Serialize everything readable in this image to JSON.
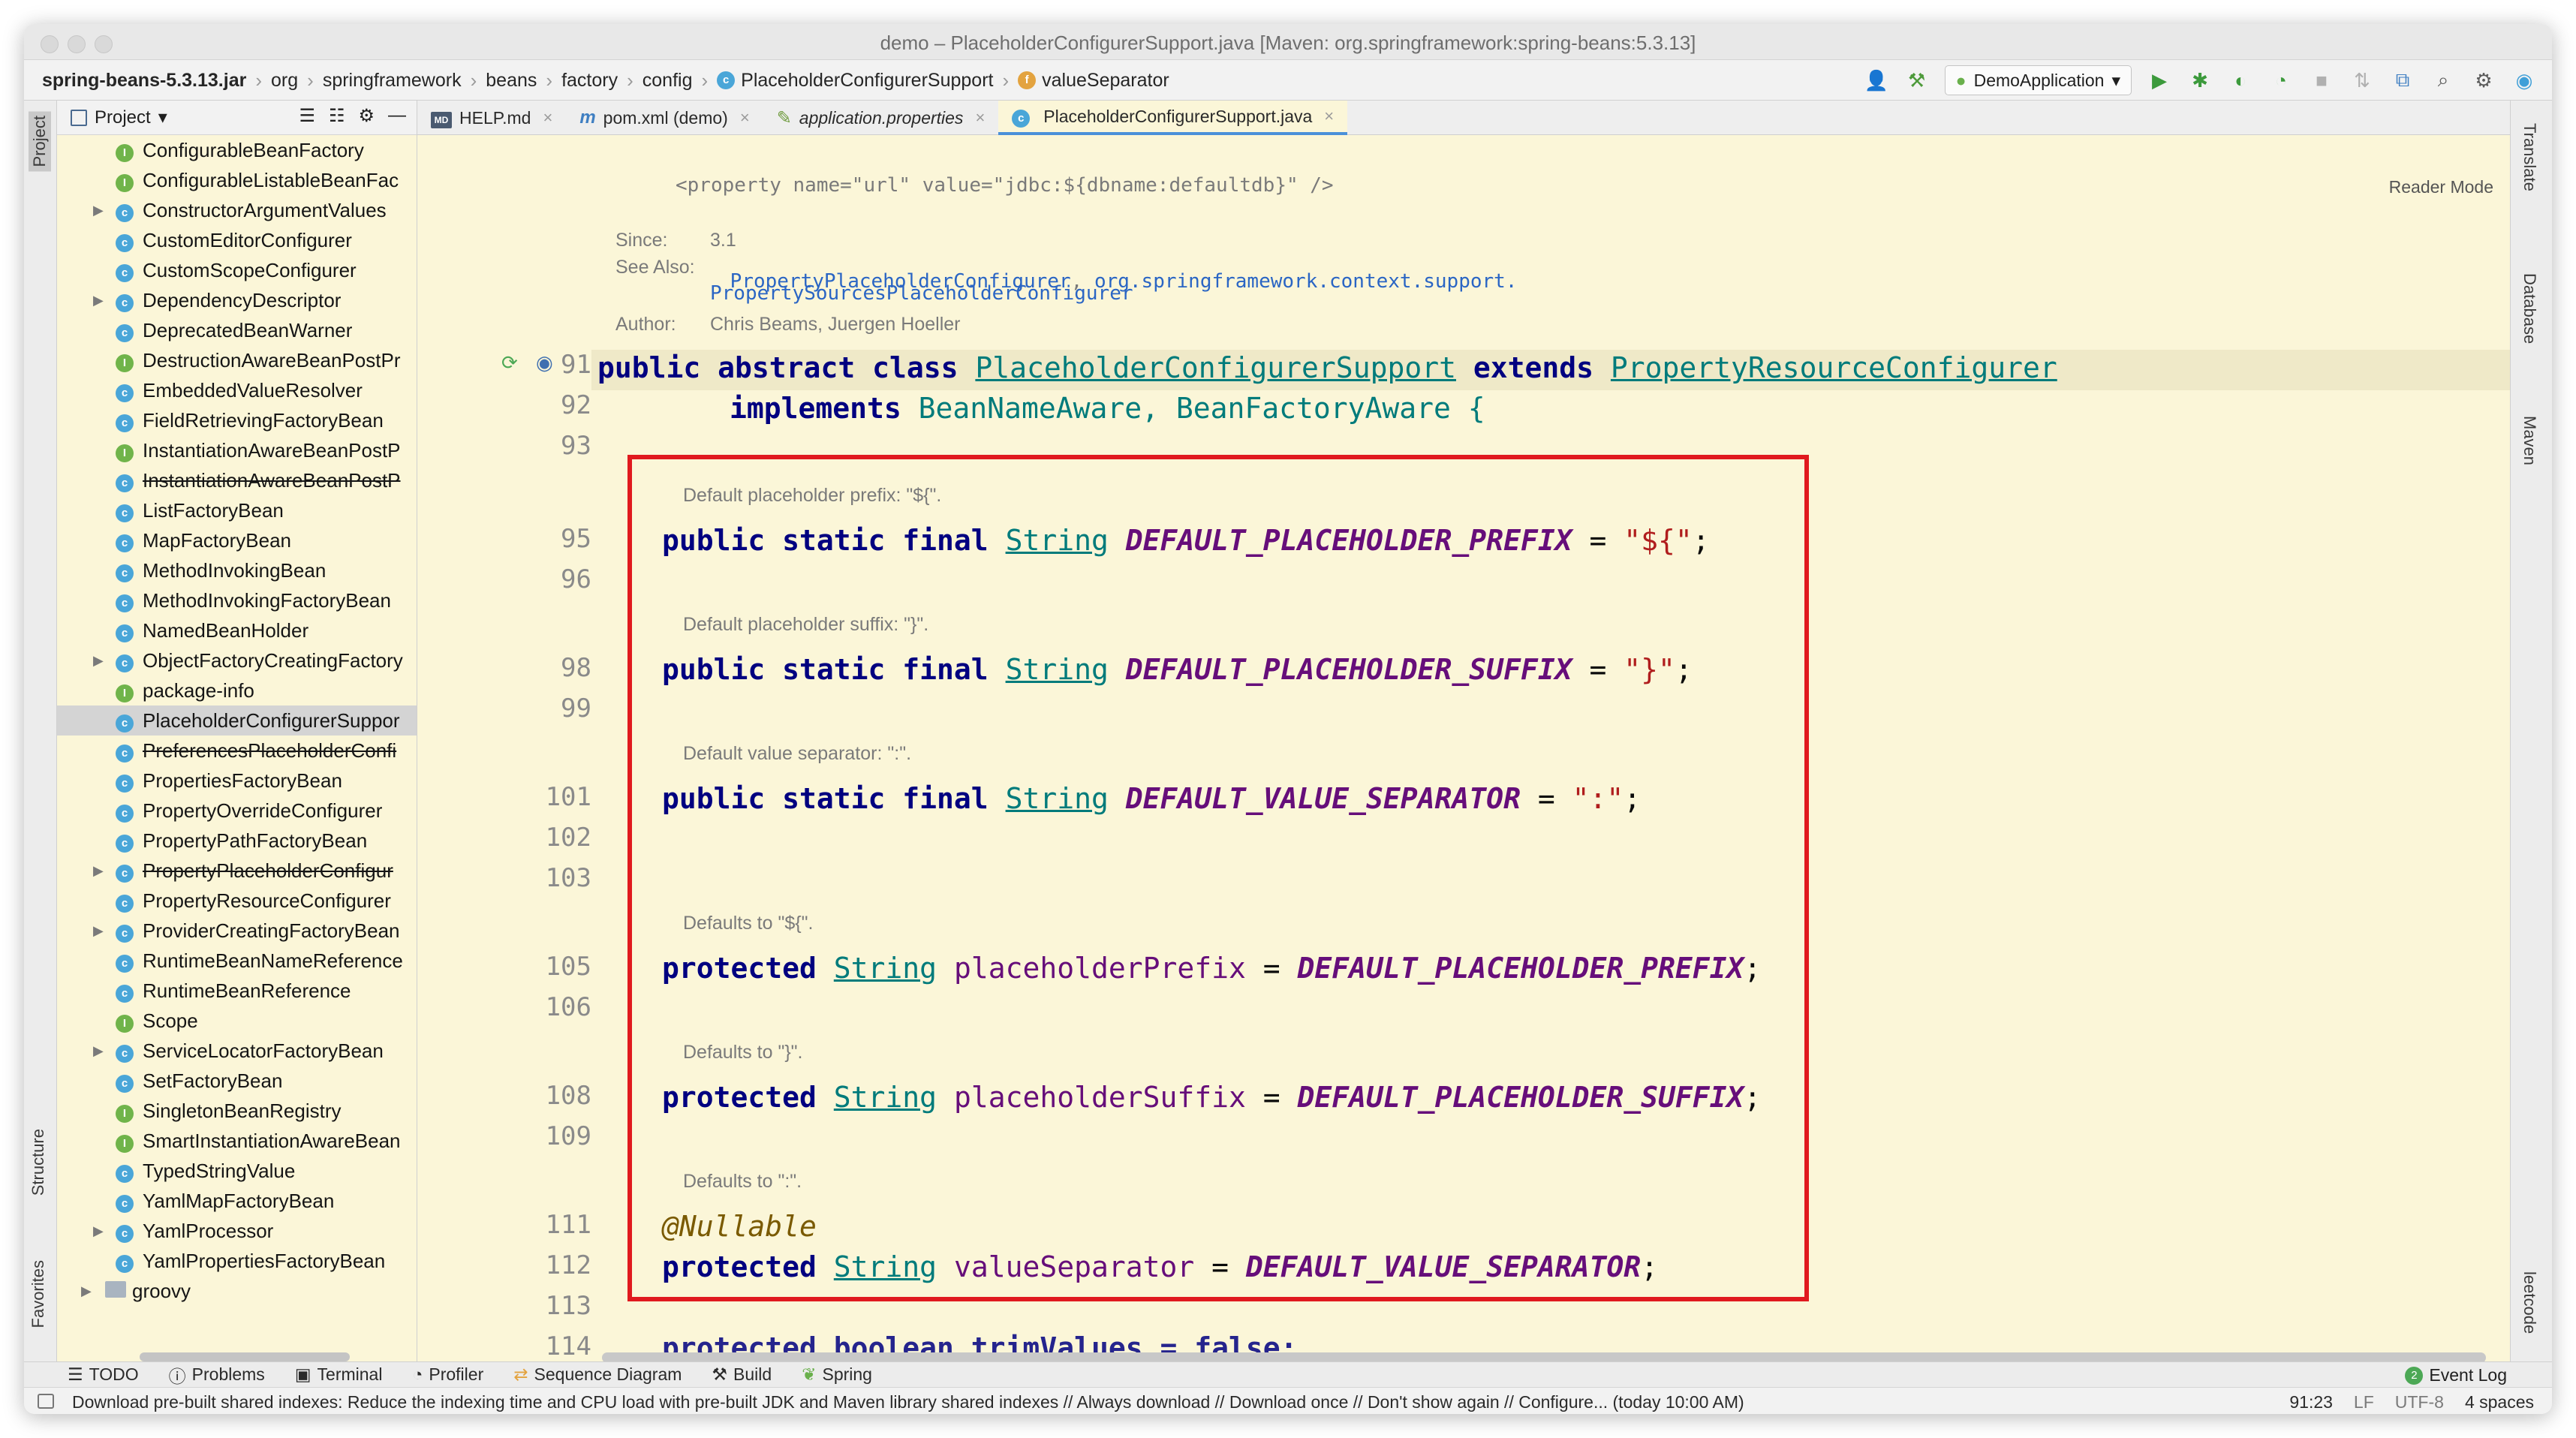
{
  "window": {
    "title": "demo – PlaceholderConfigurerSupport.java [Maven: org.springframework:spring-beans:5.3.13]"
  },
  "navbar": {
    "breadcrumbs": [
      "spring-beans-5.3.13.jar",
      "org",
      "springframework",
      "beans",
      "factory",
      "config",
      "PlaceholderConfigurerSupport",
      "valueSeparator"
    ],
    "run_config": "DemoApplication"
  },
  "left_strip": {
    "top_tab": "Project",
    "structure_tab": "Structure",
    "favorites_tab": "Favorites"
  },
  "project_panel": {
    "title": "Project",
    "items": [
      {
        "label": "ConfigurableBeanFactory",
        "icon": "interface",
        "arrow": false,
        "strike": false
      },
      {
        "label": "ConfigurableListableBeanFac",
        "icon": "interface",
        "arrow": false,
        "strike": false
      },
      {
        "label": "ConstructorArgumentValues",
        "icon": "class",
        "arrow": true,
        "strike": false
      },
      {
        "label": "CustomEditorConfigurer",
        "icon": "class",
        "arrow": false,
        "strike": false
      },
      {
        "label": "CustomScopeConfigurer",
        "icon": "class",
        "arrow": false,
        "strike": false
      },
      {
        "label": "DependencyDescriptor",
        "icon": "class",
        "arrow": true,
        "strike": false
      },
      {
        "label": "DeprecatedBeanWarner",
        "icon": "class",
        "arrow": false,
        "strike": false
      },
      {
        "label": "DestructionAwareBeanPostPr",
        "icon": "interface",
        "arrow": false,
        "strike": false
      },
      {
        "label": "EmbeddedValueResolver",
        "icon": "class",
        "arrow": false,
        "strike": false
      },
      {
        "label": "FieldRetrievingFactoryBean",
        "icon": "class",
        "arrow": false,
        "strike": false
      },
      {
        "label": "InstantiationAwareBeanPostP",
        "icon": "interface",
        "arrow": false,
        "strike": false
      },
      {
        "label": "InstantiationAwareBeanPostP",
        "icon": "class",
        "arrow": false,
        "strike": true
      },
      {
        "label": "ListFactoryBean",
        "icon": "class",
        "arrow": false,
        "strike": false
      },
      {
        "label": "MapFactoryBean",
        "icon": "class",
        "arrow": false,
        "strike": false
      },
      {
        "label": "MethodInvokingBean",
        "icon": "class",
        "arrow": false,
        "strike": false
      },
      {
        "label": "MethodInvokingFactoryBean",
        "icon": "class",
        "arrow": false,
        "strike": false
      },
      {
        "label": "NamedBeanHolder",
        "icon": "class",
        "arrow": false,
        "strike": false
      },
      {
        "label": "ObjectFactoryCreatingFactory",
        "icon": "class",
        "arrow": true,
        "strike": false
      },
      {
        "label": "package-info",
        "icon": "interface",
        "arrow": false,
        "strike": false
      },
      {
        "label": "PlaceholderConfigurerSuppor",
        "icon": "class",
        "arrow": false,
        "strike": false,
        "selected": true
      },
      {
        "label": "PreferencesPlaceholderConfi",
        "icon": "class",
        "arrow": false,
        "strike": true
      },
      {
        "label": "PropertiesFactoryBean",
        "icon": "class",
        "arrow": false,
        "strike": false
      },
      {
        "label": "PropertyOverrideConfigurer",
        "icon": "class",
        "arrow": false,
        "strike": false
      },
      {
        "label": "PropertyPathFactoryBean",
        "icon": "class",
        "arrow": false,
        "strike": false
      },
      {
        "label": "PropertyPlaceholderConfigur",
        "icon": "class",
        "arrow": true,
        "strike": true
      },
      {
        "label": "PropertyResourceConfigurer",
        "icon": "class",
        "arrow": false,
        "strike": false
      },
      {
        "label": "ProviderCreatingFactoryBean",
        "icon": "class",
        "arrow": true,
        "strike": false
      },
      {
        "label": "RuntimeBeanNameReference",
        "icon": "class",
        "arrow": false,
        "strike": false
      },
      {
        "label": "RuntimeBeanReference",
        "icon": "class",
        "arrow": false,
        "strike": false
      },
      {
        "label": "Scope",
        "icon": "interface",
        "arrow": false,
        "strike": false
      },
      {
        "label": "ServiceLocatorFactoryBean",
        "icon": "class",
        "arrow": true,
        "strike": false
      },
      {
        "label": "SetFactoryBean",
        "icon": "class",
        "arrow": false,
        "strike": false
      },
      {
        "label": "SingletonBeanRegistry",
        "icon": "interface",
        "arrow": false,
        "strike": false
      },
      {
        "label": "SmartInstantiationAwareBean",
        "icon": "interface",
        "arrow": false,
        "strike": false
      },
      {
        "label": "TypedStringValue",
        "icon": "class",
        "arrow": false,
        "strike": false
      },
      {
        "label": "YamlMapFactoryBean",
        "icon": "class",
        "arrow": false,
        "strike": false
      },
      {
        "label": "YamlProcessor",
        "icon": "class",
        "arrow": true,
        "strike": false
      },
      {
        "label": "YamlPropertiesFactoryBean",
        "icon": "class",
        "arrow": false,
        "strike": false
      },
      {
        "label": "groovy",
        "icon": "folder",
        "arrow": true,
        "strike": false
      }
    ]
  },
  "tabs": [
    {
      "label": "HELP.md",
      "icon": "md",
      "active": false
    },
    {
      "label": "pom.xml (demo)",
      "icon": "m",
      "active": false
    },
    {
      "label": "application.properties",
      "icon": "props",
      "active": false
    },
    {
      "label": "PlaceholderConfigurerSupport.java",
      "icon": "class",
      "active": true
    }
  ],
  "editor": {
    "reader_mode": "Reader Mode",
    "doc_property_line": "<property name=\"url\" value=\"jdbc:${dbname:defaultdb}\" />",
    "since_label": "Since:",
    "since_value": "3.1",
    "see_also_label": "See Also:",
    "see_also_1": "PropertyPlaceholderConfigurer",
    "see_also_sep": ", ",
    "see_also_2": "org.springframework.context.support.",
    "see_also_3": "PropertySourcesPlaceholderConfigurer",
    "author_label": "Author:",
    "author_value": "Chris Beams, Juergen Hoeller",
    "lines": [
      {
        "no": "91"
      },
      {
        "no": "92"
      },
      {
        "no": "93"
      },
      {
        "no": "95"
      },
      {
        "no": "96"
      },
      {
        "no": "98"
      },
      {
        "no": "99"
      },
      {
        "no": "101"
      },
      {
        "no": "102"
      },
      {
        "no": "103"
      },
      {
        "no": "105"
      },
      {
        "no": "106"
      },
      {
        "no": "108"
      },
      {
        "no": "109"
      },
      {
        "no": "111"
      },
      {
        "no": "112"
      },
      {
        "no": "113"
      },
      {
        "no": "114"
      }
    ],
    "code": {
      "l91_public": "public",
      "l91_abstract": "abstract",
      "l91_class": "class",
      "l91_name": "PlaceholderConfigurerSupport",
      "l91_extends": "extends",
      "l91_super": "PropertyResourceConfigurer",
      "l92_implements": "implements",
      "l92_ifaces": "BeanNameAware, BeanFactoryAware {",
      "doc_prefix": "Default placeholder prefix: \"${\".",
      "doc_suffix": "Default placeholder suffix: \"}\".",
      "doc_sep": "Default value separator: \":\".",
      "doc_def_prefix": "Defaults to \"${\".",
      "doc_def_suffix": "Defaults to \"}\".",
      "doc_def_sep": "Defaults to \":\".",
      "kw_psf": "public static final",
      "kw_protected": "protected",
      "type_string": "String",
      "c_prefix": "DEFAULT_PLACEHOLDER_PREFIX",
      "c_suffix": "DEFAULT_PLACEHOLDER_SUFFIX",
      "c_sep": "DEFAULT_VALUE_SEPARATOR",
      "eq": " = ",
      "s_prefix": "\"${\"",
      "s_suffix": "\"}\"",
      "s_sep": "\":\"",
      "semi": ";",
      "f_prefix": "placeholderPrefix",
      "f_suffix": "placeholderSuffix",
      "f_sep": "valueSeparator",
      "ann_nullable": "@Nullable",
      "l114": "protected boolean trimValues = false;"
    }
  },
  "right_strip": {
    "tabs": [
      "Translate",
      "Database",
      "Maven",
      "leetcode"
    ]
  },
  "bottom_toolbar": {
    "items": [
      "TODO",
      "Problems",
      "Terminal",
      "Profiler",
      "Sequence Diagram",
      "Build",
      "Spring"
    ],
    "event_log": "Event Log",
    "event_count": "2"
  },
  "statusbar": {
    "message": "Download pre-built shared indexes: Reduce the indexing time and CPU load with pre-built JDK and Maven library shared indexes // Always download // Download once // Don't show again // Configure... (today 10:00 AM)",
    "position": "91:23",
    "line_sep": "LF",
    "encoding": "UTF-8",
    "indent": "4 spaces"
  },
  "colors": {
    "editor_bg": "#fbf6d8",
    "highlight_box": "#e0191e",
    "keyword": "#000080",
    "constant": "#660e7a",
    "string": "#b01d1d",
    "type": "#007b7b"
  }
}
